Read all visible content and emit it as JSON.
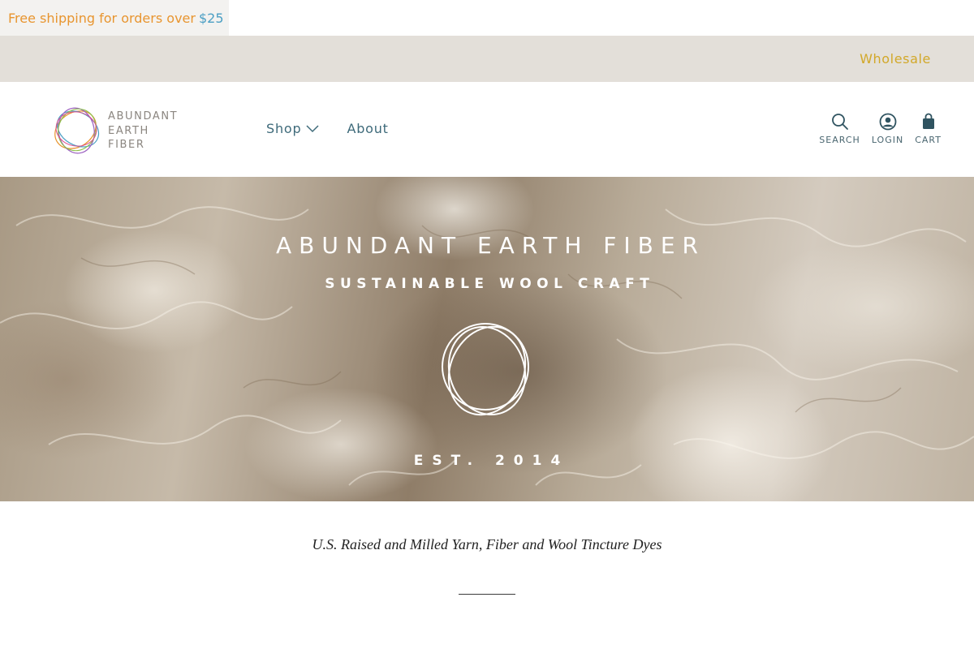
{
  "announcement": {
    "text": "Free shipping for orders over",
    "amount": "$25"
  },
  "utility_nav": {
    "wholesale": "Wholesale"
  },
  "logo": {
    "line1": "ABUNDANT",
    "line2": "EARTH",
    "line3": "FIBER"
  },
  "main_nav": {
    "shop": "Shop",
    "about": "About"
  },
  "header_icons": {
    "search": "SEARCH",
    "login": "LOGIN",
    "cart": "CART"
  },
  "hero": {
    "title": "ABUNDANT EARTH FIBER",
    "subtitle": "SUSTAINABLE WOOL CRAFT",
    "established": "EST. 2014"
  },
  "intro": {
    "tagline": "U.S. Raised and Milled Yarn, Fiber and Wool Tincture Dyes"
  },
  "colors": {
    "announcement_text": "#e8952f",
    "announcement_amount": "#4b9fc4",
    "utility_bar_bg": "#e3dfd9",
    "wholesale_link": "#d2a829",
    "nav_text": "#3e6a7a"
  }
}
